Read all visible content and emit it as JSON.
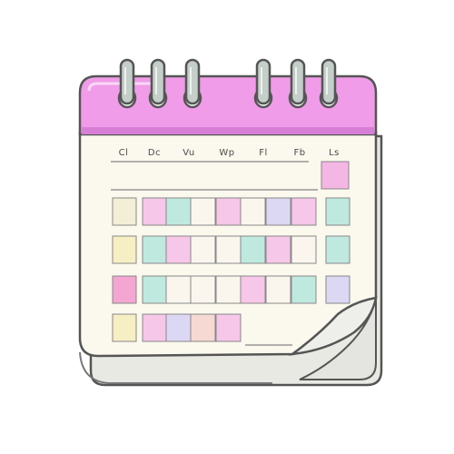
{
  "calendar": {
    "header_color": "#f09ce8",
    "header_shadow": "#d77fd6",
    "paper_color": "#fbf8ee",
    "outline_color": "#555555",
    "ring_color": "#c5cfc9",
    "day_labels": [
      "Cl",
      "Dc",
      "Vu",
      "Wp",
      "Fl",
      "Fb",
      "Ls"
    ],
    "cell_palette": {
      "cream": "#f2efd6",
      "pink": "#f6c7e8",
      "mint": "#bfe9df",
      "lavender": "#dcd7f2",
      "peach": "#f5d9d2",
      "yellow": "#f7efc4",
      "rose": "#f3a6d2",
      "blank": "#faf6ee"
    },
    "highlight_cell_color": "#f4b7e4",
    "rows": [
      [
        "cream",
        "pink",
        "mint",
        "blank",
        "pink",
        "blank",
        "lavender",
        "pink",
        "mint"
      ],
      [
        "yellow",
        "mint",
        "pink",
        "blank",
        "blank",
        "mint",
        "pink",
        "blank",
        "mint"
      ],
      [
        "rose",
        "mint",
        "blank",
        "blank",
        "blank",
        "pink",
        "blank",
        "mint",
        "lavender"
      ],
      [
        "yellow",
        "pink",
        "lavender",
        "peach",
        "pink"
      ]
    ]
  }
}
